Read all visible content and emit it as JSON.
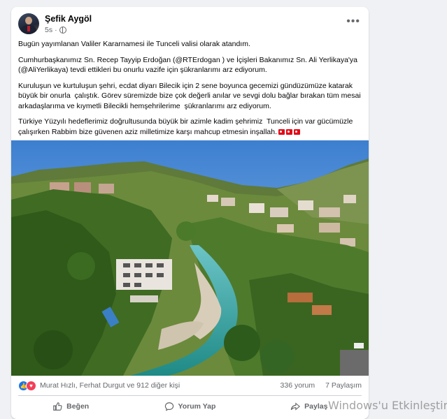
{
  "post": {
    "author": "Şefik Aygöl",
    "time": "5s",
    "more_label": "•••",
    "paragraphs": [
      "Bugün yayımlanan Valiler Kararnamesi ile Tunceli valisi olarak atandım.",
      "Cumhurbaşkanımız Sn. Recep Tayyip Erdoğan (@RTErdogan ) ve İçişleri Bakanımız Sn. Ali Yerlikaya'ya (@AliYerlikaya) tevdi ettikleri bu onurlu vazife için şükranlarımı arz ediyorum.",
      "Kuruluşun ve kurtuluşun şehri, ecdat diyarı Bilecik için 2 sene boyunca gecemizi gündüzümüze katarak büyük bir onurla  çalıştık. Görev süremizde bize çok değerli anılar ve sevgi dolu bağlar bırakan tüm mesai arkadaşlarıma ve kıymetli Bilecikli hemşehrilerime  şükranlarımı arz ediyorum.",
      "Türkiye Yüzyılı hedeflerimiz doğrultusunda büyük bir azimle kadim şehrimiz  Tunceli için var gücümüzle  çalışırken Rabbim bize güvenen aziz milletimize karşı mahcup etmesin inşallah."
    ],
    "flag_icons": [
      "turkish-flag",
      "turkish-flag",
      "turkish-flag"
    ]
  },
  "stats": {
    "reaction_icons": [
      "like-icon",
      "love-icon"
    ],
    "reactors": "Murat Hızlı, Ferhat Durgut ve 912 diğer kişi",
    "comments": "336 yorum",
    "shares": "7 Paylaşım"
  },
  "actions": {
    "like": "Beğen",
    "comment": "Yorum Yap",
    "share": "Paylaş"
  },
  "watermark": "Windows'u Etkinleştir",
  "colors": {
    "page_bg": "#eff1f4",
    "card_bg": "#ffffff",
    "secondary_text": "#65676b",
    "like_blue": "#1877f2",
    "love_red": "#f33e58",
    "flag_red": "#e30a17"
  }
}
